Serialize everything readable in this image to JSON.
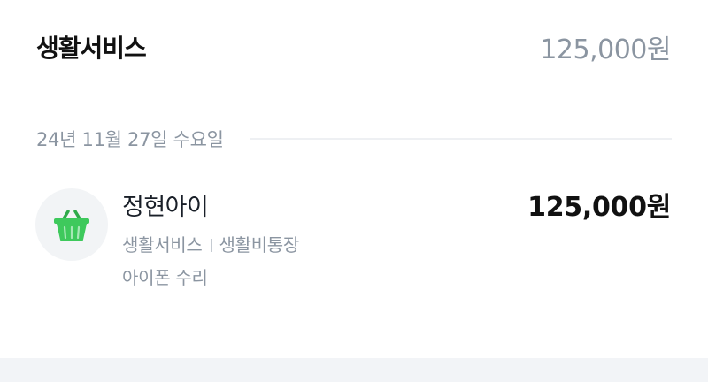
{
  "header": {
    "title": "생활서비스",
    "total": "125,000원"
  },
  "date_group": {
    "label": "24년 11월 27일 수요일"
  },
  "transactions": [
    {
      "icon": "shopping-basket-icon",
      "icon_color": "#3ec95c",
      "merchant": "정현아이",
      "amount": "125,000원",
      "category": "생활서비스",
      "account": "생활비통장",
      "memo": "아이폰 수리"
    }
  ],
  "colors": {
    "secondary_text": "#8b95a1",
    "icon_background": "#f2f4f6",
    "divider": "#eef0f3"
  }
}
